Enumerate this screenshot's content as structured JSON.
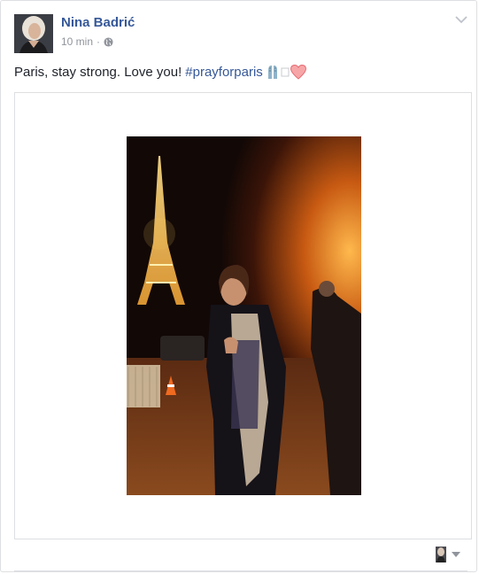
{
  "post": {
    "author_name": "Nina Badrić",
    "timestamp": "10 min",
    "separator": "·",
    "privacy_icon": "globe-icon",
    "status_text": "Paris, stay strong. Love you!",
    "hashtag": "#prayforparis",
    "emojis": [
      "pray-emoji",
      "heart-emoji"
    ]
  },
  "colors": {
    "link_blue": "#365899",
    "meta_gray": "#90949c",
    "border": "#dddfe2",
    "heart": "#f0797e"
  }
}
